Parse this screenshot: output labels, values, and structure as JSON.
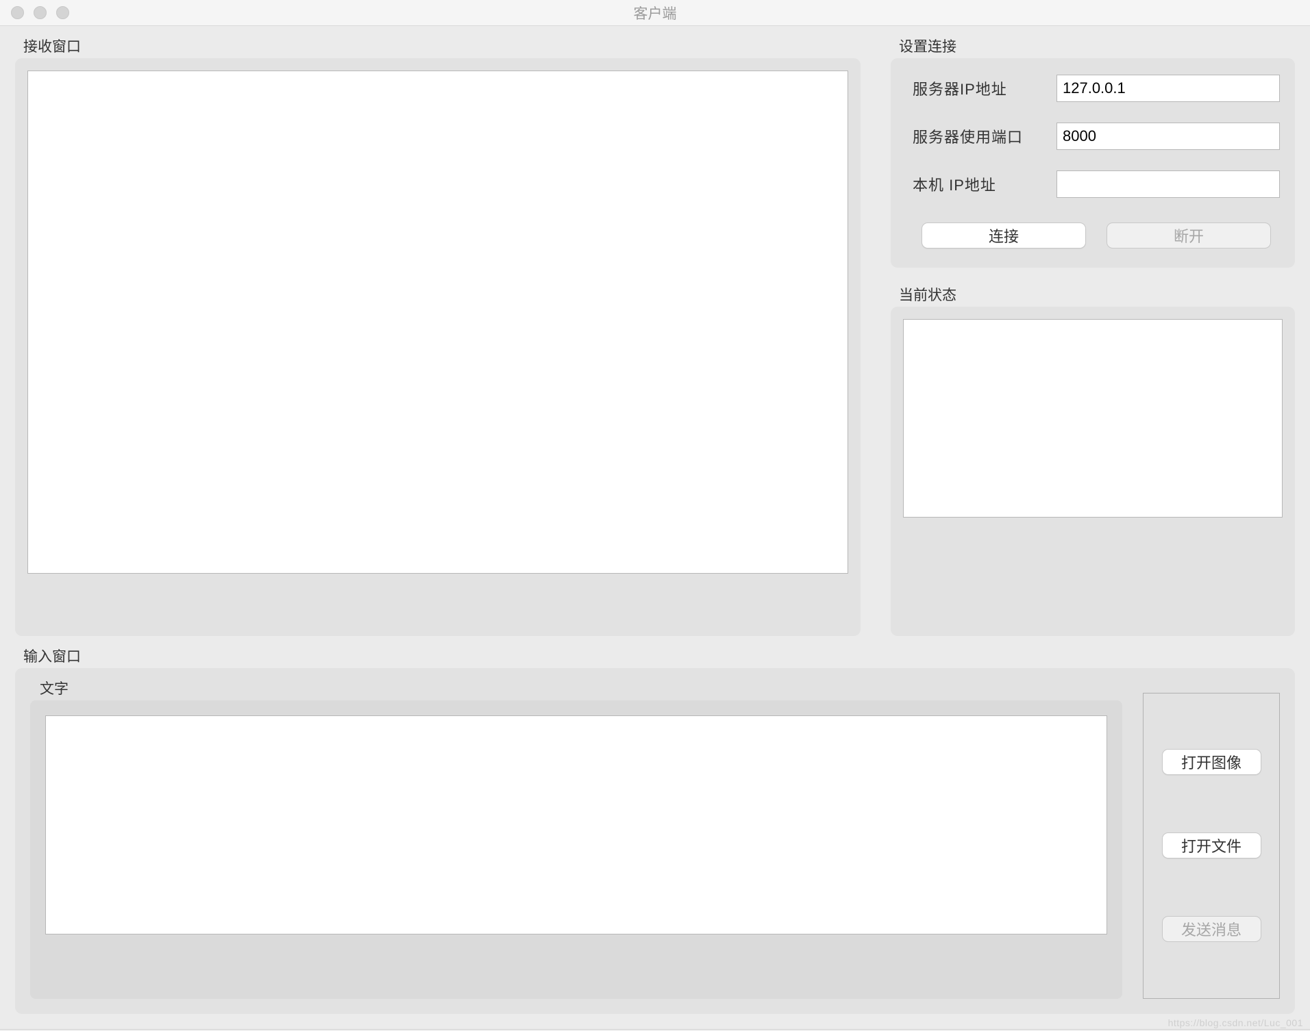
{
  "window": {
    "title": "客户端"
  },
  "receive": {
    "title": "接收窗口",
    "value": ""
  },
  "settings": {
    "title": "设置连接",
    "server_ip_label": "服务器IP地址",
    "server_ip_value": "127.0.0.1",
    "server_port_label": "服务器使用端口",
    "server_port_value": "8000",
    "local_ip_label": "本机 IP地址",
    "local_ip_value": "",
    "connect_label": "连接",
    "disconnect_label": "断开"
  },
  "status": {
    "title": "当前状态",
    "value": ""
  },
  "input": {
    "title": "输入窗口",
    "text_group_title": "文字",
    "text_value": "",
    "open_image_label": "打开图像",
    "open_file_label": "打开文件",
    "send_label": "发送消息"
  },
  "watermark": "https://blog.csdn.net/Luc_001"
}
